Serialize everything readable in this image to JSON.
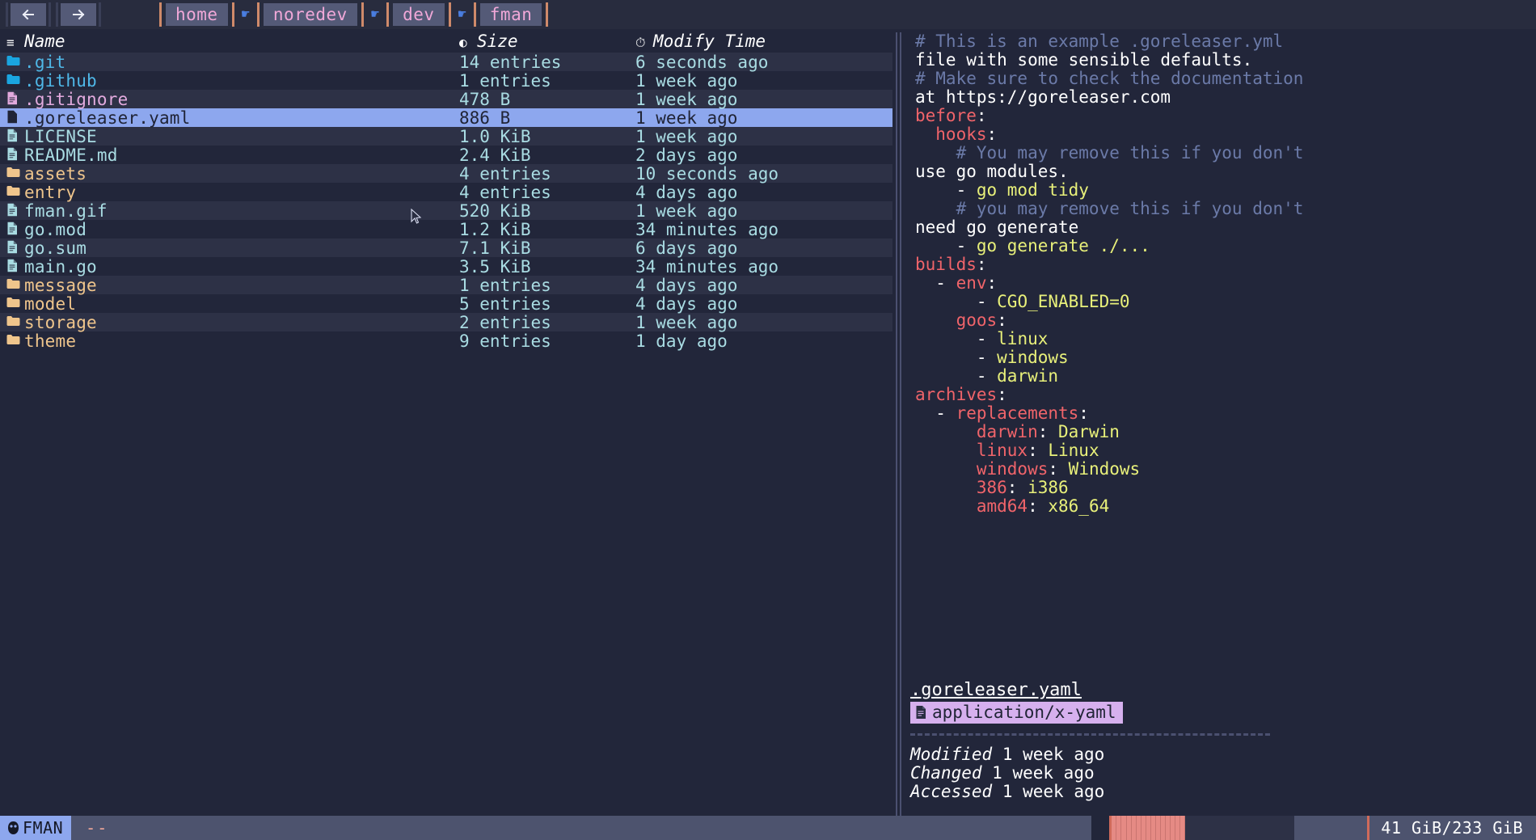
{
  "app": {
    "name": "fman",
    "status_badge": "FMAN",
    "status_badge_icon": "owl-icon",
    "status_message": "--"
  },
  "toolbar": {
    "back_label": "←",
    "forward_label": "→",
    "breadcrumb_separator_icon": "pointing-hand-icon",
    "breadcrumbs": [
      {
        "label": "home"
      },
      {
        "label": "noredev"
      },
      {
        "label": "dev"
      },
      {
        "label": "fman"
      }
    ]
  },
  "filelist": {
    "headers": {
      "name": "Name",
      "size": "Size",
      "time": "Modify Time",
      "name_icon": "list-icon",
      "size_icon": "pie-chart-icon",
      "time_icon": "clock-icon"
    },
    "rows": [
      {
        "name": ".git",
        "size": "14 entries",
        "time": "6 seconds ago",
        "kind": "folder",
        "color": "blue",
        "icon": "folder-icon",
        "selected": false
      },
      {
        "name": ".github",
        "size": "1 entries",
        "time": "1 week ago",
        "kind": "folder",
        "color": "blue",
        "icon": "folder-icon",
        "selected": false
      },
      {
        "name": ".gitignore",
        "size": "478 B",
        "time": "1 week ago",
        "kind": "file",
        "color": "pink",
        "icon": "file-icon",
        "selected": false
      },
      {
        "name": ".goreleaser.yaml",
        "size": "886 B",
        "time": "1 week ago",
        "kind": "file",
        "color": "dark",
        "icon": "file-icon",
        "selected": true
      },
      {
        "name": "LICENSE",
        "size": "1.0 KiB",
        "time": "1 week ago",
        "kind": "file",
        "color": "cyan",
        "icon": "file-icon",
        "selected": false
      },
      {
        "name": "README.md",
        "size": "2.4 KiB",
        "time": "2 days ago",
        "kind": "file",
        "color": "cyan",
        "icon": "file-icon",
        "selected": false
      },
      {
        "name": "assets",
        "size": "4 entries",
        "time": "10 seconds ago",
        "kind": "folder",
        "color": "tan",
        "icon": "folder-icon",
        "selected": false
      },
      {
        "name": "entry",
        "size": "4 entries",
        "time": "4 days ago",
        "kind": "folder",
        "color": "tan",
        "icon": "folder-icon",
        "selected": false
      },
      {
        "name": "fman.gif",
        "size": "520 KiB",
        "time": "1 week ago",
        "kind": "file",
        "color": "cyan",
        "icon": "file-icon",
        "selected": false
      },
      {
        "name": "go.mod",
        "size": "1.2 KiB",
        "time": "34 minutes ago",
        "kind": "file",
        "color": "cyan",
        "icon": "file-icon",
        "selected": false
      },
      {
        "name": "go.sum",
        "size": "7.1 KiB",
        "time": "6 days ago",
        "kind": "file",
        "color": "cyan",
        "icon": "file-icon",
        "selected": false
      },
      {
        "name": "main.go",
        "size": "3.5 KiB",
        "time": "34 minutes ago",
        "kind": "file",
        "color": "cyan",
        "icon": "file-icon",
        "selected": false
      },
      {
        "name": "message",
        "size": "1 entries",
        "time": "4 days ago",
        "kind": "folder",
        "color": "tan",
        "icon": "folder-icon",
        "selected": false
      },
      {
        "name": "model",
        "size": "5 entries",
        "time": "4 days ago",
        "kind": "folder",
        "color": "tan",
        "icon": "folder-icon",
        "selected": false
      },
      {
        "name": "storage",
        "size": "2 entries",
        "time": "1 week ago",
        "kind": "folder",
        "color": "tan",
        "icon": "folder-icon",
        "selected": false
      },
      {
        "name": "theme",
        "size": "9 entries",
        "time": "1 day ago",
        "kind": "folder",
        "color": "tan",
        "icon": "folder-icon",
        "selected": false
      }
    ]
  },
  "preview": {
    "lines": [
      [
        {
          "t": "# This is an example .goreleaser.yml",
          "c": "comment"
        }
      ],
      [
        {
          "t": "file with some sensible defaults.",
          "c": "plain"
        }
      ],
      [
        {
          "t": "# Make sure to check the documentation",
          "c": "comment"
        }
      ],
      [
        {
          "t": "at https://goreleaser.com",
          "c": "plain"
        }
      ],
      [
        {
          "t": "before",
          "c": "key"
        },
        {
          "t": ":",
          "c": "plain"
        }
      ],
      [
        {
          "t": "  hooks",
          "c": "key"
        },
        {
          "t": ":",
          "c": "plain"
        }
      ],
      [
        {
          "t": "    # You may remove this if you don't",
          "c": "comment"
        }
      ],
      [
        {
          "t": "use go modules.",
          "c": "plain"
        }
      ],
      [
        {
          "t": "    - ",
          "c": "dash"
        },
        {
          "t": "go mod tidy",
          "c": "val"
        }
      ],
      [
        {
          "t": "    # you may remove this if you don't",
          "c": "comment"
        }
      ],
      [
        {
          "t": "need go generate",
          "c": "plain"
        }
      ],
      [
        {
          "t": "    - ",
          "c": "dash"
        },
        {
          "t": "go generate ./...",
          "c": "val"
        }
      ],
      [
        {
          "t": "builds",
          "c": "key"
        },
        {
          "t": ":",
          "c": "plain"
        }
      ],
      [
        {
          "t": "  - ",
          "c": "dash"
        },
        {
          "t": "env",
          "c": "key"
        },
        {
          "t": ":",
          "c": "plain"
        }
      ],
      [
        {
          "t": "      - ",
          "c": "dash"
        },
        {
          "t": "CGO_ENABLED=0",
          "c": "val"
        }
      ],
      [
        {
          "t": "    goos",
          "c": "key"
        },
        {
          "t": ":",
          "c": "plain"
        }
      ],
      [
        {
          "t": "      - ",
          "c": "dash"
        },
        {
          "t": "linux",
          "c": "val"
        }
      ],
      [
        {
          "t": "      - ",
          "c": "dash"
        },
        {
          "t": "windows",
          "c": "val"
        }
      ],
      [
        {
          "t": "      - ",
          "c": "dash"
        },
        {
          "t": "darwin",
          "c": "val"
        }
      ],
      [
        {
          "t": "archives",
          "c": "key"
        },
        {
          "t": ":",
          "c": "plain"
        }
      ],
      [
        {
          "t": "  - ",
          "c": "dash"
        },
        {
          "t": "replacements",
          "c": "key"
        },
        {
          "t": ":",
          "c": "plain"
        }
      ],
      [
        {
          "t": "      darwin",
          "c": "key"
        },
        {
          "t": ": ",
          "c": "plain"
        },
        {
          "t": "Darwin",
          "c": "val"
        }
      ],
      [
        {
          "t": "      linux",
          "c": "key"
        },
        {
          "t": ": ",
          "c": "plain"
        },
        {
          "t": "Linux",
          "c": "val"
        }
      ],
      [
        {
          "t": "      windows",
          "c": "key"
        },
        {
          "t": ": ",
          "c": "plain"
        },
        {
          "t": "Windows",
          "c": "val"
        }
      ],
      [
        {
          "t": "      386",
          "c": "key"
        },
        {
          "t": ": ",
          "c": "plain"
        },
        {
          "t": "i386",
          "c": "val"
        }
      ],
      [
        {
          "t": "      amd64",
          "c": "key"
        },
        {
          "t": ": ",
          "c": "plain"
        },
        {
          "t": "x86_64",
          "c": "val"
        }
      ]
    ],
    "meta": {
      "filename": ".goreleaser.yaml",
      "mime": "application/x-yaml",
      "mime_icon": "file-icon",
      "modified_label": "Modified",
      "modified_value": "1 week ago",
      "changed_label": "Changed",
      "changed_value": "1 week ago",
      "accessed_label": "Accessed",
      "accessed_value": "1 week ago"
    }
  },
  "statusbar": {
    "disk_usage": "41 GiB/233 GiB",
    "disk_percent": 40
  },
  "colors": {
    "background": "#22263a",
    "row_alt": "#2d3146",
    "selection": "#8da7ee",
    "accent_pink": "#f0a8d8",
    "accent_red": "#f0646a",
    "accent_yellow": "#e8f07a",
    "accent_purple": "#d6b0ee",
    "accent_salmon": "#e58a84"
  }
}
